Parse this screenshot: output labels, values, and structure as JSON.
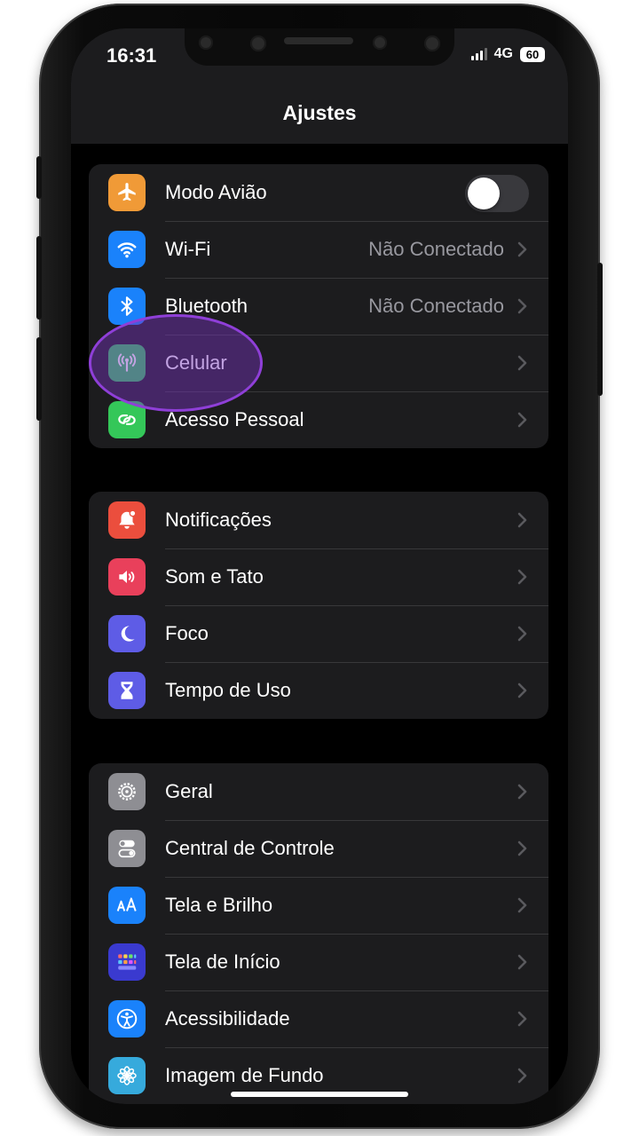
{
  "status_bar": {
    "time": "16:31",
    "network": "4G",
    "battery": "60"
  },
  "header": {
    "title": "Ajustes"
  },
  "groups": [
    {
      "items": [
        {
          "label": "Modo Avião",
          "value": "",
          "icon": "airplane-icon",
          "color": "#f09a37",
          "control": "toggle",
          "toggle_on": false
        },
        {
          "label": "Wi-Fi",
          "value": "Não Conectado",
          "icon": "wifi-icon",
          "color": "#1a82fb"
        },
        {
          "label": "Bluetooth",
          "value": "Não Conectado",
          "icon": "bluetooth-icon",
          "color": "#1a82fb"
        },
        {
          "label": "Celular",
          "value": "",
          "icon": "cellular-antenna-icon",
          "color": "#34c759",
          "highlighted": true
        },
        {
          "label": "Acesso Pessoal",
          "value": "",
          "icon": "personal-hotspot-icon",
          "color": "#34c759"
        }
      ]
    },
    {
      "items": [
        {
          "label": "Notificações",
          "icon": "bell-icon",
          "color": "#eb4e3d"
        },
        {
          "label": "Som e Tato",
          "icon": "speaker-icon",
          "color": "#e9405b"
        },
        {
          "label": "Foco",
          "icon": "moon-icon",
          "color": "#5e5ce6"
        },
        {
          "label": "Tempo de Uso",
          "icon": "hourglass-icon",
          "color": "#5e5ce6"
        }
      ]
    },
    {
      "items": [
        {
          "label": "Geral",
          "icon": "gear-icon",
          "color": "#8e8e93"
        },
        {
          "label": "Central de Controle",
          "icon": "switches-icon",
          "color": "#8e8e93"
        },
        {
          "label": "Tela e Brilho",
          "icon": "text-size-icon",
          "color": "#1a82fb"
        },
        {
          "label": "Tela de Início",
          "icon": "home-screen-grid-icon",
          "color": "#3a3acf"
        },
        {
          "label": "Acessibilidade",
          "icon": "accessibility-icon",
          "color": "#1a82fb"
        },
        {
          "label": "Imagem de Fundo",
          "icon": "flower-icon",
          "color": "#36aadc"
        }
      ]
    }
  ]
}
